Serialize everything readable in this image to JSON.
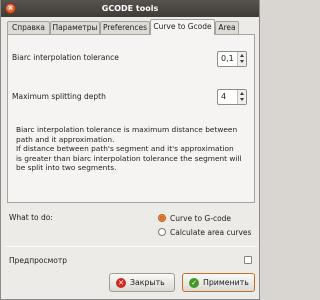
{
  "window": {
    "title": "GCODE tools",
    "close_glyph": "×"
  },
  "tabs": [
    {
      "label": "Справка"
    },
    {
      "label": "Параметры"
    },
    {
      "label": "Preferences"
    },
    {
      "label": "Curve to Gcode",
      "active": true
    },
    {
      "label": "Area"
    }
  ],
  "panel": {
    "biarc_label": "Biarc interpolation tolerance",
    "biarc_value": "0,1",
    "split_label": "Maximum splitting depth",
    "split_value": "4",
    "help_lines": [
      "Biarc interpolation tolerance is maximum distance between",
      "path and it approximation.",
      "If distance between path's segment and it's approximation",
      "is greater than biarc interpolation tolerance the segment will",
      "be split into two segments."
    ]
  },
  "what_to_do": {
    "label": "What to do:",
    "options": [
      {
        "label": "Curve to G-code",
        "selected": true
      },
      {
        "label": "Calculate area curves",
        "selected": false
      }
    ]
  },
  "preview": {
    "label": "Предпросмотр",
    "checked": false
  },
  "buttons": {
    "close_label": "Закрыть",
    "close_glyph": "✕",
    "apply_label": "Применить",
    "apply_glyph": "✓"
  },
  "colors": {
    "accent": "#e07b28",
    "titlebar": "#4a4641",
    "close_button": "#de5a24"
  },
  "icons": {
    "title_close": "close-icon",
    "close_button": "x-icon",
    "apply_button": "check-icon"
  }
}
